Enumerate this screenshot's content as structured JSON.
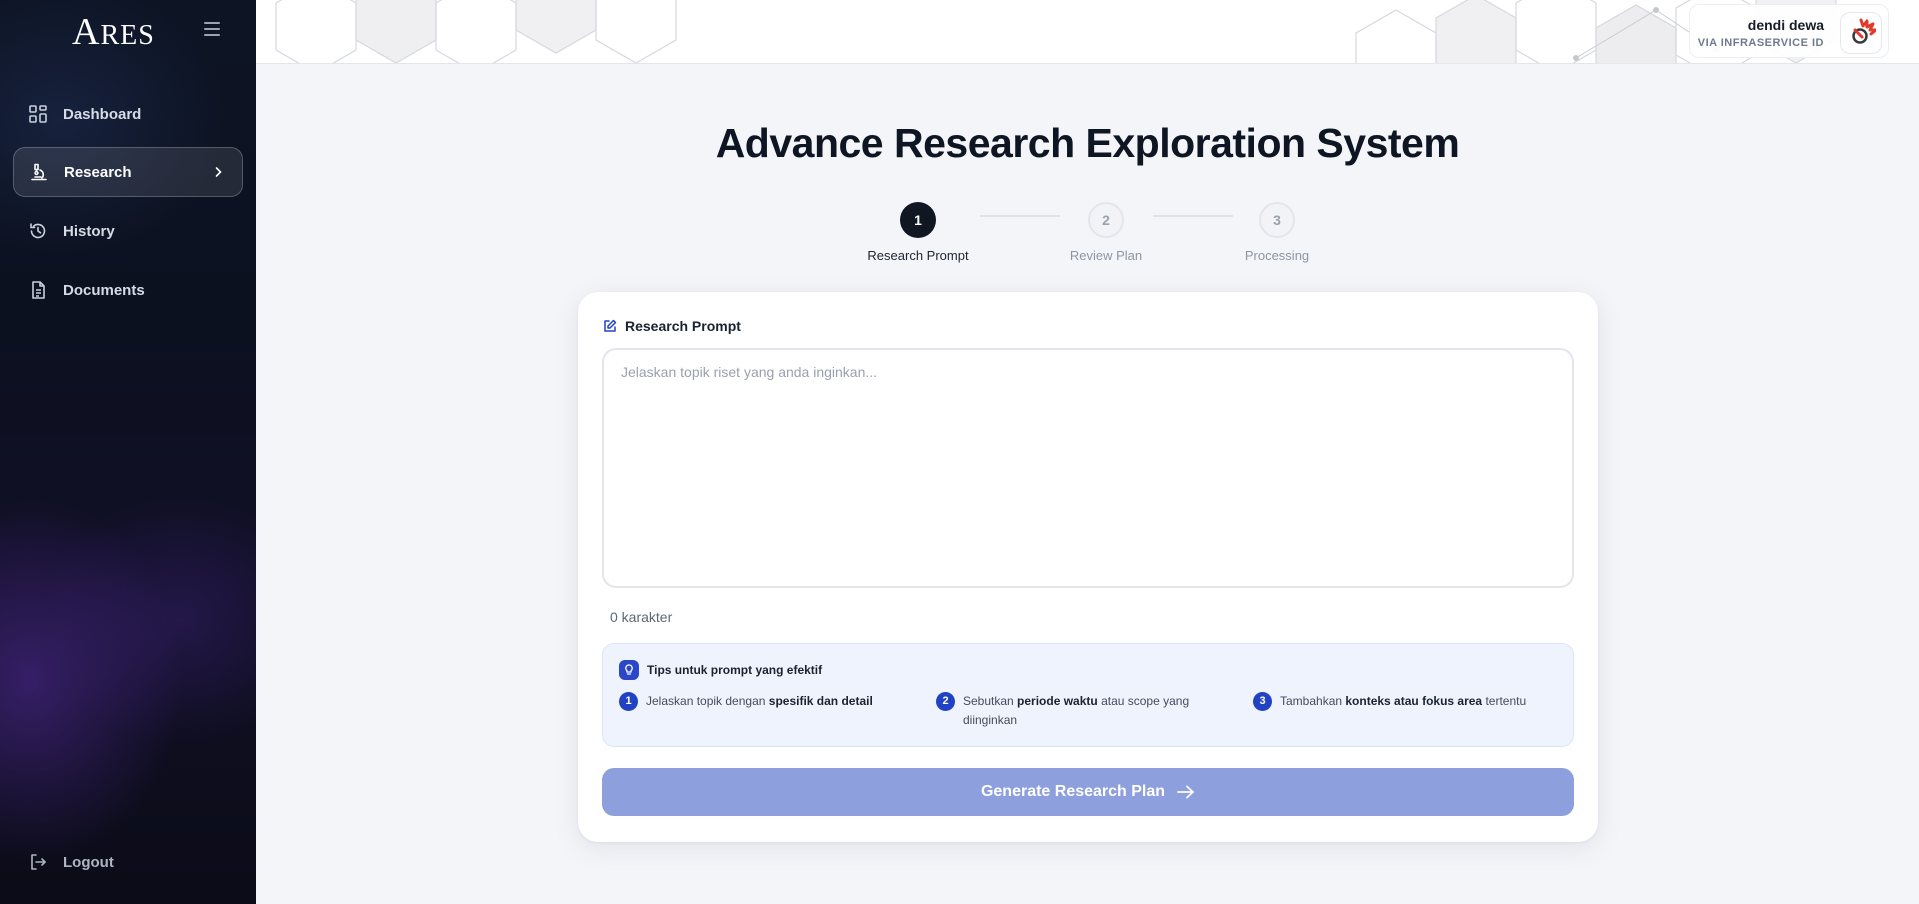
{
  "brand": {
    "logo_text": "ARES",
    "logo_first": "A",
    "logo_rest": "RES"
  },
  "sidebar": {
    "items": [
      {
        "label": "Dashboard",
        "icon": "dashboard-icon"
      },
      {
        "label": "Research",
        "icon": "microscope-icon",
        "active": true
      },
      {
        "label": "History",
        "icon": "history-icon"
      },
      {
        "label": "Documents",
        "icon": "document-icon"
      }
    ],
    "logout_label": "Logout"
  },
  "header": {
    "user_name": "dendi dewa",
    "user_org": "VIA INFRASERVICE ID"
  },
  "main": {
    "title": "Advance Research Exploration System",
    "steps": [
      {
        "number": "1",
        "label": "Research Prompt",
        "state": "active"
      },
      {
        "number": "2",
        "label": "Review Plan",
        "state": "pending"
      },
      {
        "number": "3",
        "label": "Processing",
        "state": "pending"
      }
    ],
    "prompt_label": "Research Prompt",
    "prompt_placeholder": "Jelaskan topik riset yang anda inginkan...",
    "prompt_value": "",
    "char_count": "0 karakter",
    "tips": {
      "title": "Tips untuk prompt yang efektif",
      "items": [
        {
          "number": "1",
          "pre": "Jelaskan topik dengan ",
          "bold": "spesifik dan detail",
          "post": ""
        },
        {
          "number": "2",
          "pre": "Sebutkan ",
          "bold": "periode waktu",
          "post": " atau scope yang diinginkan"
        },
        {
          "number": "3",
          "pre": "Tambahkan ",
          "bold": "konteks atau fokus area",
          "post": " tertentu"
        }
      ]
    },
    "generate_label": "Generate Research Plan"
  },
  "colors": {
    "sidebar_bg": "#0d1424",
    "primary_dark": "#101722",
    "accent_blue": "#2242c4",
    "button_disabled": "#8d9fdc",
    "tips_bg": "#eef3fe"
  }
}
